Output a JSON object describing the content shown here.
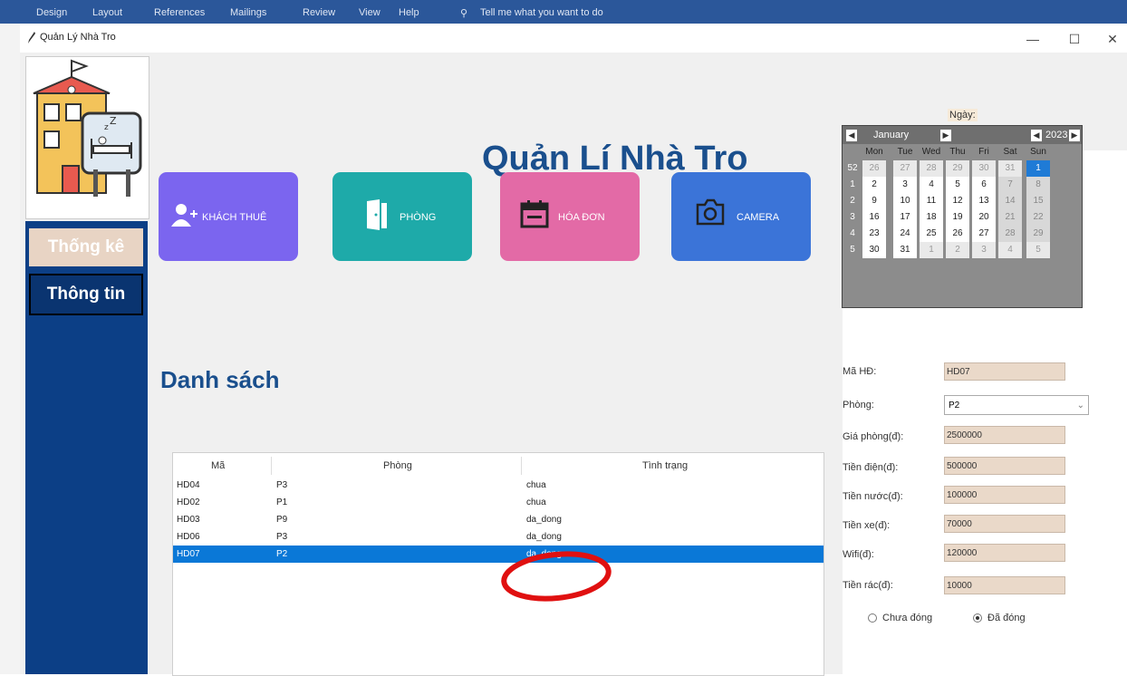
{
  "ribbon": {
    "items": [
      "Design",
      "Layout",
      "References",
      "Mailings",
      "Review",
      "View",
      "Help",
      "Tell me what you want to do"
    ]
  },
  "window": {
    "title": "Quản Lý Nhà Tro",
    "minimize": "—",
    "maximize": "☐",
    "close": "✕"
  },
  "sidebar": {
    "items": [
      {
        "label": "Thống kê"
      },
      {
        "label": "Thông tin"
      }
    ]
  },
  "header": {
    "title": "Quản Lí Nhà Trọ"
  },
  "actions": [
    {
      "label": "KHÁCH THUÊ",
      "icon": "add-user-icon",
      "color": "#7b65ef"
    },
    {
      "label": "PHÒNG",
      "icon": "door-icon",
      "color": "#1eaaa9"
    },
    {
      "label": "HÓA ĐƠN",
      "icon": "calendar-icon",
      "color": "#e36aa6"
    },
    {
      "label": "CAMERA",
      "icon": "camera-icon",
      "color": "#3b74d8"
    }
  ],
  "list": {
    "title": "Danh sách",
    "columns": [
      "Mã",
      "Phòng",
      "Tình trạng"
    ],
    "rows": [
      {
        "ma": "HD04",
        "phong": "P3",
        "tinh_trang": "chua"
      },
      {
        "ma": "HD02",
        "phong": "P1",
        "tinh_trang": "chua"
      },
      {
        "ma": "HD03",
        "phong": "P9",
        "tinh_trang": "da_dong"
      },
      {
        "ma": "HD06",
        "phong": "P3",
        "tinh_trang": "da_dong"
      },
      {
        "ma": "HD07",
        "phong": "P2",
        "tinh_trang": "da_dong"
      }
    ],
    "selected_row": "HD07"
  },
  "calendar": {
    "label": "Ngày:",
    "month": "January",
    "year": "2023",
    "day_names": [
      "Mon",
      "Tue",
      "Wed",
      "Thu",
      "Fri",
      "Sat",
      "Sun"
    ],
    "weeks": [
      {
        "wk": "52",
        "days": [
          "26",
          "27",
          "28",
          "29",
          "30",
          "31",
          "1"
        ]
      },
      {
        "wk": "1",
        "days": [
          "2",
          "3",
          "4",
          "5",
          "6",
          "7",
          "8"
        ]
      },
      {
        "wk": "2",
        "days": [
          "9",
          "10",
          "11",
          "12",
          "13",
          "14",
          "15"
        ]
      },
      {
        "wk": "3",
        "days": [
          "16",
          "17",
          "18",
          "19",
          "20",
          "21",
          "22"
        ]
      },
      {
        "wk": "4",
        "days": [
          "23",
          "24",
          "25",
          "26",
          "27",
          "28",
          "29"
        ]
      },
      {
        "wk": "5",
        "days": [
          "30",
          "31",
          "1",
          "2",
          "3",
          "4",
          "5"
        ]
      }
    ],
    "selected_day": "1"
  },
  "form": {
    "ma_hd": {
      "label": "Mã HĐ:",
      "value": "HD07"
    },
    "phong": {
      "label": "Phòng:",
      "value": "P2"
    },
    "gia_phong": {
      "label": "Giá phòng(đ):",
      "value": "2500000"
    },
    "tien_dien": {
      "label": "Tiền điện(đ):",
      "value": "500000"
    },
    "tien_nuoc": {
      "label": "Tiền nước(đ):",
      "value": "100000"
    },
    "tien_xe": {
      "label": "Tiền xe(đ):",
      "value": "70000"
    },
    "wifi": {
      "label": "Wifi(đ):",
      "value": "120000"
    },
    "tien_rac": {
      "label": "Tiền rác(đ):",
      "value": "10000"
    }
  },
  "status_radio": {
    "options": [
      {
        "label": "Chưa đóng",
        "checked": false
      },
      {
        "label": "Đã đóng",
        "checked": true
      }
    ]
  },
  "colors": {
    "sidebar": "#0c3f86",
    "title": "#1a4f8d",
    "selection": "#0a78d7",
    "field_bg": "#ead9c9"
  }
}
